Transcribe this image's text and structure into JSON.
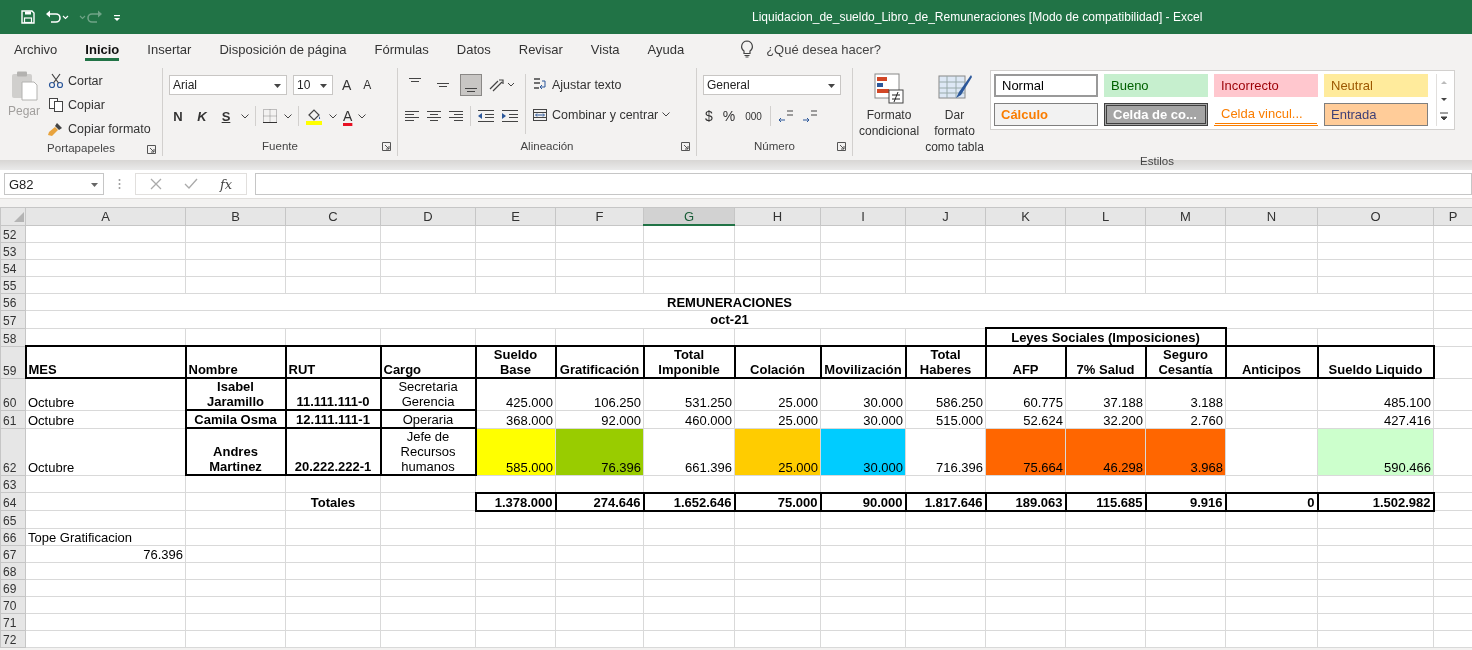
{
  "window": {
    "title": "Liquidacion_de_sueldo_Libro_de_Remuneraciones  [Modo de compatibilidad]  -  Excel"
  },
  "quick_access": [
    {
      "kind": "save",
      "disabled": false
    },
    {
      "kind": "undo",
      "disabled": false
    },
    {
      "kind": "redo",
      "disabled": true
    },
    {
      "kind": "customize",
      "disabled": false
    }
  ],
  "menu_tabs": [
    {
      "label": "Archivo",
      "selected": false
    },
    {
      "label": "Inicio",
      "selected": true
    },
    {
      "label": "Insertar",
      "selected": false
    },
    {
      "label": "Disposición de página",
      "selected": false
    },
    {
      "label": "Fórmulas",
      "selected": false
    },
    {
      "label": "Datos",
      "selected": false
    },
    {
      "label": "Revisar",
      "selected": false
    },
    {
      "label": "Vista",
      "selected": false
    },
    {
      "label": "Ayuda",
      "selected": false
    }
  ],
  "tell_me": {
    "placeholder": "¿Qué desea hacer?"
  },
  "ribbon": {
    "clipboard": {
      "label": "Portapapeles",
      "paste": {
        "label": "Pegar",
        "disabled": true
      },
      "actions": [
        {
          "kind": "cut",
          "label": "Cortar"
        },
        {
          "kind": "copy",
          "label": "Copiar"
        },
        {
          "kind": "painter",
          "label": "Copiar formato"
        }
      ]
    },
    "font": {
      "label": "Fuente",
      "family": "Arial",
      "size": "10",
      "grow": "A",
      "shrink": "A",
      "styles": [
        "N",
        "K",
        "S"
      ],
      "font_color": "A"
    },
    "alignment": {
      "label": "Alineación",
      "vertical": [
        {
          "kind": "top",
          "selected": false
        },
        {
          "kind": "middle",
          "selected": false
        },
        {
          "kind": "bottom",
          "selected": true
        }
      ],
      "wrap": "Ajustar texto",
      "merge": "Combinar y centrar"
    },
    "number": {
      "label": "Número",
      "format": "General",
      "symbols": [
        "$",
        "%",
        "000"
      ]
    },
    "styles": {
      "label": "Estilos",
      "conditional": "Formato condicional",
      "as_table": "Dar formato como tabla",
      "cells": [
        {
          "label": "Normal",
          "kind": "normal",
          "color": "#ffffff",
          "selected": true
        },
        {
          "label": "Bueno",
          "kind": "good",
          "color": "#c6efce",
          "selected": false
        },
        {
          "label": "Incorrecto",
          "kind": "bad",
          "color": "#ffc7ce",
          "selected": false
        },
        {
          "label": "Neutral",
          "kind": "neutral",
          "color": "#ffeb9c",
          "selected": false
        },
        {
          "label": "Cálculo",
          "kind": "calculation",
          "color": "#f2f2f2",
          "selected": false
        },
        {
          "label": "Celda de co...",
          "kind": "check",
          "color": "#a5a5a5",
          "selected": false
        },
        {
          "label": "Celda vincul...",
          "kind": "linked",
          "color": "#ffffff",
          "selected": false
        },
        {
          "label": "Entrada",
          "kind": "input",
          "color": "#ffcc99",
          "selected": false
        }
      ]
    }
  },
  "formula_bar": {
    "name_box": "G82",
    "fx": "fx"
  },
  "sheet": {
    "columns": [
      {
        "label": "A",
        "selected": false
      },
      {
        "label": "B",
        "selected": false
      },
      {
        "label": "C",
        "selected": false
      },
      {
        "label": "D",
        "selected": false
      },
      {
        "label": "E",
        "selected": false
      },
      {
        "label": "F",
        "selected": false
      },
      {
        "label": "G",
        "selected": true
      },
      {
        "label": "H",
        "selected": false
      },
      {
        "label": "I",
        "selected": false
      },
      {
        "label": "J",
        "selected": false
      },
      {
        "label": "K",
        "selected": false
      },
      {
        "label": "L",
        "selected": false
      },
      {
        "label": "M",
        "selected": false
      },
      {
        "label": "N",
        "selected": false
      },
      {
        "label": "O",
        "selected": false
      },
      {
        "label": "P",
        "selected": false
      }
    ],
    "rows": [
      {
        "number": "52"
      },
      {
        "number": "53"
      },
      {
        "number": "54"
      },
      {
        "number": "55"
      },
      {
        "number": "56",
        "cells": [
          {
            "kind": "title",
            "text": "REMUNERACIONES"
          }
        ]
      },
      {
        "number": "57",
        "cells": [
          {
            "kind": "title",
            "text": "oct-21"
          }
        ]
      },
      {
        "number": "58",
        "cells": [
          null,
          null,
          null,
          null,
          null,
          null,
          null,
          null,
          null,
          null,
          {
            "kind": "group",
            "text": "Leyes Sociales (Imposiciones)"
          }
        ]
      },
      {
        "number": "59",
        "cells": [
          {
            "kind": "caption",
            "text": "MES"
          },
          {
            "kind": "caption",
            "text": "Nombre"
          },
          {
            "kind": "caption",
            "text": "RUT"
          },
          {
            "kind": "caption",
            "text": "Cargo"
          },
          {
            "kind": "heading",
            "text": "Sueldo Base"
          },
          {
            "kind": "heading",
            "text": "Gratificación"
          },
          {
            "kind": "heading",
            "text": "Total Imponible"
          },
          {
            "kind": "heading",
            "text": "Colación"
          },
          {
            "kind": "heading",
            "text": "Movilización"
          },
          {
            "kind": "heading",
            "text": "Total Haberes"
          },
          {
            "kind": "heading",
            "text": "AFP"
          },
          {
            "kind": "heading",
            "text": "7% Salud"
          },
          {
            "kind": "heading",
            "text": "Seguro Cesantía"
          },
          {
            "kind": "heading",
            "text": "Anticipos"
          },
          {
            "kind": "heading",
            "text": "Sueldo Liquido"
          }
        ]
      },
      {
        "number": "60",
        "cells": [
          {
            "kind": "text",
            "text": "Octubre"
          },
          {
            "kind": "name",
            "text": "Isabel Jaramillo"
          },
          {
            "kind": "name",
            "text": "11.111.111-0"
          },
          {
            "kind": "center",
            "text": "Secretaria Gerencia"
          },
          {
            "kind": "number",
            "text": "425.000"
          },
          {
            "kind": "number",
            "text": "106.250"
          },
          {
            "kind": "number",
            "text": "531.250"
          },
          {
            "kind": "number",
            "text": "25.000"
          },
          {
            "kind": "number",
            "text": "30.000"
          },
          {
            "kind": "number",
            "text": "586.250"
          },
          {
            "kind": "number",
            "text": "60.775"
          },
          {
            "kind": "number",
            "text": "37.188"
          },
          {
            "kind": "number",
            "text": "3.188"
          },
          null,
          {
            "kind": "number",
            "text": "485.100"
          }
        ]
      },
      {
        "number": "61",
        "cells": [
          {
            "kind": "text",
            "text": "Octubre"
          },
          {
            "kind": "name",
            "text": "Camila Osma"
          },
          {
            "kind": "name",
            "text": "12.111.111-1"
          },
          {
            "kind": "center",
            "text": "Operaria"
          },
          {
            "kind": "number",
            "text": "368.000"
          },
          {
            "kind": "number",
            "text": "92.000"
          },
          {
            "kind": "number",
            "text": "460.000"
          },
          {
            "kind": "number",
            "text": "25.000"
          },
          {
            "kind": "number",
            "text": "30.000"
          },
          {
            "kind": "number",
            "text": "515.000"
          },
          {
            "kind": "number",
            "text": "52.624"
          },
          {
            "kind": "number",
            "text": "32.200"
          },
          {
            "kind": "number",
            "text": "2.760"
          },
          null,
          {
            "kind": "number",
            "text": "427.416"
          }
        ]
      },
      {
        "number": "62",
        "cells": [
          {
            "kind": "text",
            "text": "Octubre"
          },
          {
            "kind": "name",
            "text": "Andres Martinez"
          },
          {
            "kind": "name",
            "text": "20.222.222-1"
          },
          {
            "kind": "center",
            "text": "Jefe de Recursos humanos"
          },
          {
            "kind": "number",
            "text": "585.000",
            "color": "#ffff00"
          },
          {
            "kind": "number",
            "text": "76.396",
            "color": "#99cc00"
          },
          {
            "kind": "number",
            "text": "661.396"
          },
          {
            "kind": "number",
            "text": "25.000",
            "color": "#ffcc00"
          },
          {
            "kind": "number",
            "text": "30.000",
            "color": "#00ccff"
          },
          {
            "kind": "number",
            "text": "716.396"
          },
          {
            "kind": "number",
            "text": "75.664",
            "color": "#ff6600"
          },
          {
            "kind": "number",
            "text": "46.298",
            "color": "#ff6600"
          },
          {
            "kind": "number",
            "text": "3.968",
            "color": "#ff6600"
          },
          null,
          {
            "kind": "number",
            "text": "590.466",
            "color": "#ccffcc"
          }
        ]
      },
      {
        "number": "63"
      },
      {
        "number": "64",
        "cells": [
          null,
          null,
          {
            "kind": "strong",
            "text": "Totales"
          },
          null,
          {
            "kind": "total",
            "text": "1.378.000"
          },
          {
            "kind": "total",
            "text": "274.646"
          },
          {
            "kind": "total",
            "text": "1.652.646"
          },
          {
            "kind": "total",
            "text": "75.000"
          },
          {
            "kind": "total",
            "text": "90.000"
          },
          {
            "kind": "total",
            "text": "1.817.646"
          },
          {
            "kind": "total",
            "text": "189.063"
          },
          {
            "kind": "total",
            "text": "115.685"
          },
          {
            "kind": "total",
            "text": "9.916"
          },
          {
            "kind": "total",
            "text": "0"
          },
          {
            "kind": "total",
            "text": "1.502.982"
          }
        ]
      },
      {
        "number": "65"
      },
      {
        "number": "66",
        "cells": [
          {
            "kind": "text",
            "text": "Tope Gratificacion"
          }
        ]
      },
      {
        "number": "67",
        "cells": [
          {
            "kind": "number",
            "text": "76.396"
          }
        ]
      },
      {
        "number": "68"
      },
      {
        "number": "69"
      },
      {
        "number": "70"
      },
      {
        "number": "71"
      },
      {
        "number": "72"
      }
    ]
  }
}
